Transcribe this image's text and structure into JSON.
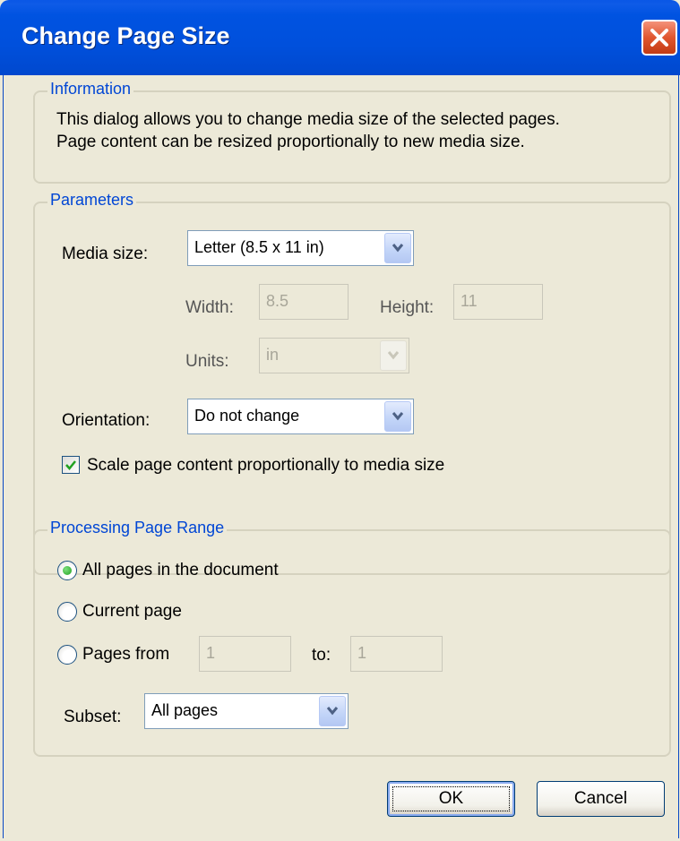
{
  "window": {
    "title": "Change Page Size"
  },
  "information": {
    "legend": "Information",
    "line1": "This dialog allows you to change media size of the selected pages.",
    "line2": "Page content can be resized proportionally to new media size."
  },
  "parameters": {
    "legend": "Parameters",
    "media_size_label": "Media size:",
    "media_size_value": "Letter (8.5 x 11 in)",
    "width_label": "Width:",
    "width_value": "8.5",
    "height_label": "Height:",
    "height_value": "11",
    "units_label": "Units:",
    "units_value": "in",
    "orientation_label": "Orientation:",
    "orientation_value": "Do not change",
    "scale_label": "Scale page content proportionally to media size",
    "scale_checked": true
  },
  "range": {
    "legend": "Processing Page Range",
    "all_pages_label": "All pages in the document",
    "current_page_label": "Current page",
    "pages_from_label": "Pages from",
    "from_value": "1",
    "to_label": "to:",
    "to_value": "1",
    "selected": "all",
    "subset_label": "Subset:",
    "subset_value": "All pages"
  },
  "buttons": {
    "ok": "OK",
    "cancel": "Cancel"
  },
  "colors": {
    "titlebar": "#0053e1",
    "legend": "#0046d5",
    "dialog_bg": "#ece9d8"
  }
}
